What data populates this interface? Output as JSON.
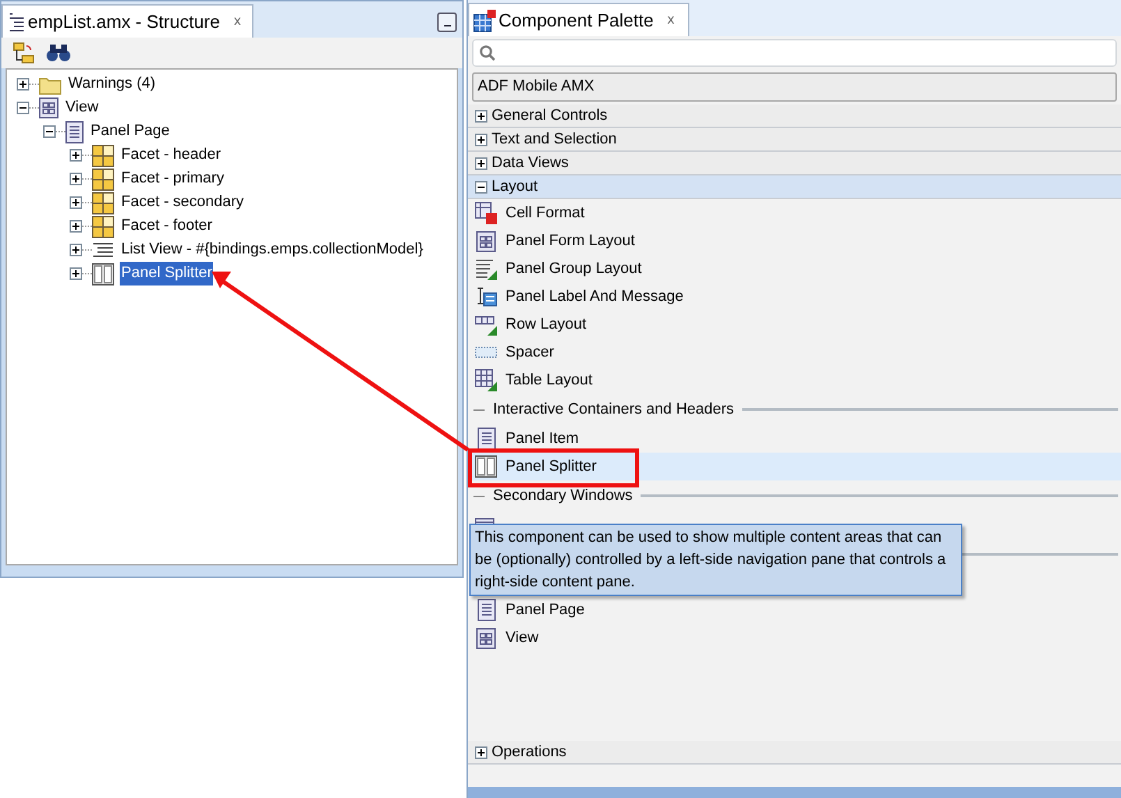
{
  "structure_panel": {
    "tab": {
      "title": "empList.amx - Structure",
      "close": "x"
    },
    "tree": [
      {
        "label": "Warnings (4)",
        "kind": "folder",
        "expanded": false,
        "selected": false
      },
      {
        "label": "View",
        "kind": "view",
        "expanded": true,
        "selected": false,
        "children": [
          {
            "label": "Panel Page",
            "kind": "page",
            "expanded": true,
            "selected": false,
            "children": [
              {
                "label": "Facet - header",
                "kind": "facet",
                "expanded": false,
                "selected": false
              },
              {
                "label": "Facet - primary",
                "kind": "facet",
                "expanded": false,
                "selected": false
              },
              {
                "label": "Facet - secondary",
                "kind": "facet",
                "expanded": false,
                "selected": false
              },
              {
                "label": "Facet - footer",
                "kind": "facet",
                "expanded": false,
                "selected": false
              },
              {
                "label": "List View - #{bindings.emps.collectionModel}",
                "kind": "list",
                "expanded": false,
                "selected": false
              },
              {
                "label": "Panel Splitter",
                "kind": "splitter",
                "expanded": false,
                "selected": true
              }
            ]
          }
        ]
      }
    ]
  },
  "palette": {
    "tab": {
      "title": "Component Palette",
      "close": "x"
    },
    "library": "ADF Mobile AMX",
    "categories": [
      {
        "label": "General Controls",
        "expanded": false
      },
      {
        "label": "Text and Selection",
        "expanded": false
      },
      {
        "label": "Data Views",
        "expanded": false
      },
      {
        "label": "Layout",
        "expanded": true,
        "entries": [
          {
            "kind": "cell-format",
            "label": "Cell Format",
            "selected": false
          },
          {
            "kind": "view",
            "label": "Panel Form Layout",
            "selected": false
          },
          {
            "kind": "group-layout",
            "label": "Panel Group Layout",
            "selected": false
          },
          {
            "kind": "label-message",
            "label": "Panel Label And Message",
            "selected": false
          },
          {
            "kind": "row-layout",
            "label": "Row Layout",
            "selected": false
          },
          {
            "kind": "spacer",
            "label": "Spacer",
            "selected": false
          },
          {
            "kind": "table-layout",
            "label": "Table Layout",
            "selected": false
          },
          {
            "kind": "section",
            "label": "Interactive Containers and Headers"
          },
          {
            "kind": "page",
            "label": "Panel Item",
            "selected": false
          },
          {
            "kind": "splitter",
            "label": "Panel Splitter",
            "selected": true
          },
          {
            "kind": "section",
            "label": "Secondary Windows"
          },
          {
            "kind": "popup",
            "selected": false
          },
          {
            "kind": "section"
          },
          {
            "kind": "page",
            "label": "Panel Page",
            "selected": false
          },
          {
            "kind": "view",
            "label": "View",
            "selected": false
          }
        ]
      },
      {
        "label": "Operations",
        "expanded": false
      }
    ],
    "tooltip": "This component can be used to show multiple content areas that can be (optionally) controlled by a left-side navigation pane that controls a right-side content pane."
  }
}
